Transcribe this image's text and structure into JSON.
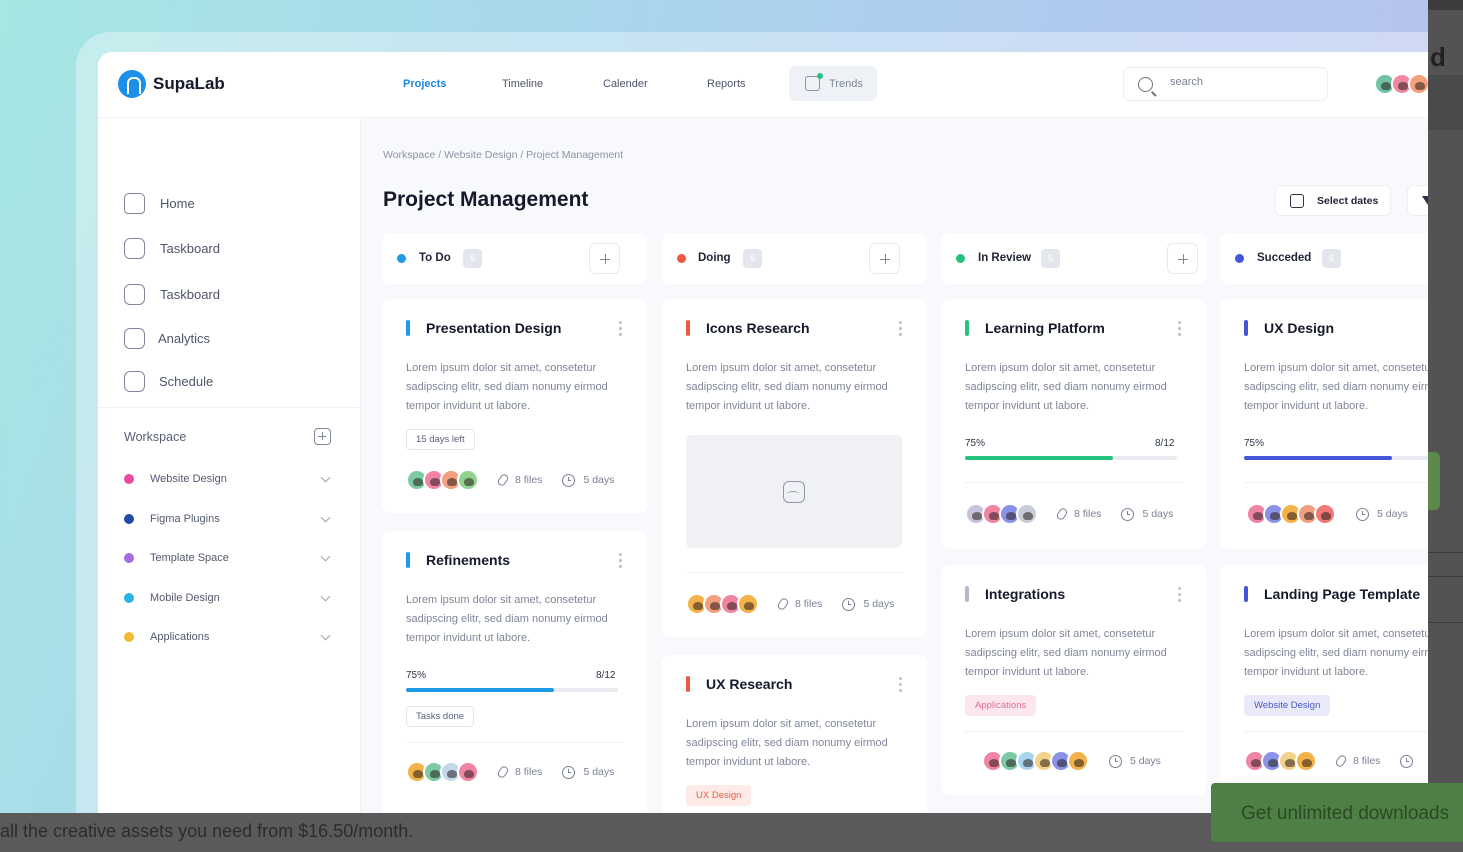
{
  "app": {
    "name": "SupaLab"
  },
  "nav": {
    "projects": "Projects",
    "timeline": "Timeline",
    "calender": "Calender",
    "reports": "Reports",
    "trends": "Trends"
  },
  "search": {
    "placeholder": "search"
  },
  "sidebar": {
    "items": [
      {
        "label": "Home",
        "icon": "home-icon"
      },
      {
        "label": "Taskboard",
        "icon": "taskboard-icon"
      },
      {
        "label": "Taskboard",
        "icon": "taskboard-icon"
      },
      {
        "label": "Analytics",
        "icon": "analytics-icon"
      },
      {
        "label": "Schedule",
        "icon": "schedule-icon"
      }
    ],
    "workspace_title": "Workspace",
    "workspace": [
      {
        "label": "Website Design",
        "color": "#e94aa0"
      },
      {
        "label": "Figma Plugins",
        "color": "#1f4aa8"
      },
      {
        "label": "Template Space",
        "color": "#a56de0"
      },
      {
        "label": "Mobile Design",
        "color": "#2bb3e8"
      },
      {
        "label": "Applications",
        "color": "#f2bb35"
      }
    ]
  },
  "main": {
    "breadcrumb": "Workspace / Website Design / Project Management",
    "title": "Project Management",
    "select_dates": "Select dates"
  },
  "columns": [
    {
      "label": "To Do",
      "count": "6",
      "color": "#1f9ae8"
    },
    {
      "label": "Doing",
      "count": "6",
      "color": "#ee5a40"
    },
    {
      "label": "In Review",
      "count": "6",
      "color": "#25c27f"
    },
    {
      "label": "Succeded",
      "count": "6",
      "color": "#4555d8"
    }
  ],
  "cards": {
    "presentation": {
      "title": "Presentation Design",
      "desc": "Lorem ipsum dolor sit amet, consetetur sadipscing elitr, sed diam nonumy eirmod tempor invidunt ut labore.",
      "tag": "15 days left",
      "files": "8 files",
      "days": "5 days"
    },
    "refinements": {
      "title": "Refinements",
      "desc": "Lorem ipsum dolor sit amet, consetetur sadipscing elitr, sed diam nonumy eirmod tempor invidunt ut labore.",
      "progress_label": "75%",
      "progress": 0.7,
      "progress_count": "8/12",
      "tag": "Tasks done",
      "files": "8 files",
      "days": "5 days"
    },
    "icons_research": {
      "title": "Icons Research",
      "desc": "Lorem ipsum dolor sit amet, consetetur sadipscing elitr, sed diam nonumy eirmod tempor invidunt ut labore.",
      "files": "8 files",
      "days": "5 days"
    },
    "ux_research": {
      "title": "UX Research",
      "desc": "Lorem ipsum dolor sit amet, consetetur sadipscing elitr, sed diam nonumy eirmod tempor invidunt ut labore.",
      "tag": "UX Design"
    },
    "learning": {
      "title": "Learning Platform",
      "desc": "Lorem ipsum dolor sit amet, consetetur sadipscing elitr, sed diam nonumy eirmod tempor invidunt ut labore.",
      "progress_label": "75%",
      "progress": 0.7,
      "progress_count": "8/12",
      "files": "8 files",
      "days": "5 days"
    },
    "integrations": {
      "title": "Integrations",
      "desc": "Lorem ipsum dolor sit amet, consetetur sadipscing elitr, sed diam nonumy eirmod tempor invidunt ut labore.",
      "tag": "Applications",
      "days": "5 days"
    },
    "ux_design": {
      "title": "UX Design",
      "desc": "Lorem ipsum dolor sit amet, consetetur sadipscing elitr, sed diam nonumy eirmod tempor invidunt ut labore.",
      "progress_label": "75%",
      "progress": 0.7,
      "days": "5 days"
    },
    "landing": {
      "title": "Landing Page Template",
      "desc": "Lorem ipsum dolor sit amet, consetetur sadipscing elitr, sed diam nonumy eirmod tempor invidunt ut labore.",
      "tag": "Website Design",
      "files": "8 files"
    }
  },
  "overlay": {
    "message": "all the creative assets you need from $16.50/month.",
    "cta": "Get unlimited downloads"
  }
}
